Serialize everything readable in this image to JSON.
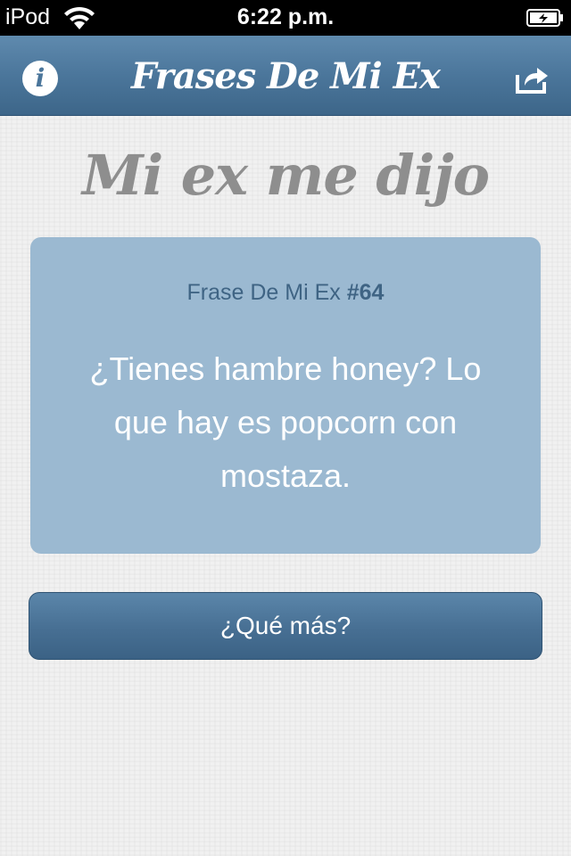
{
  "status_bar": {
    "carrier": "iPod",
    "time": "6:22 p.m."
  },
  "navbar": {
    "title": "Frases De Mi Ex",
    "info_label": "i"
  },
  "heading": "Mi ex me dijo",
  "card": {
    "label_prefix": "Frase De Mi Ex ",
    "label_number": "#64",
    "quote": "¿Tienes hambre honey? Lo que hay es popcorn con mostaza."
  },
  "more_button": {
    "label": "¿Qué más?"
  },
  "colors": {
    "nav_blue": "#4b769b",
    "card_blue": "#9bb9d1",
    "heading_gray": "#8e8e8e"
  }
}
